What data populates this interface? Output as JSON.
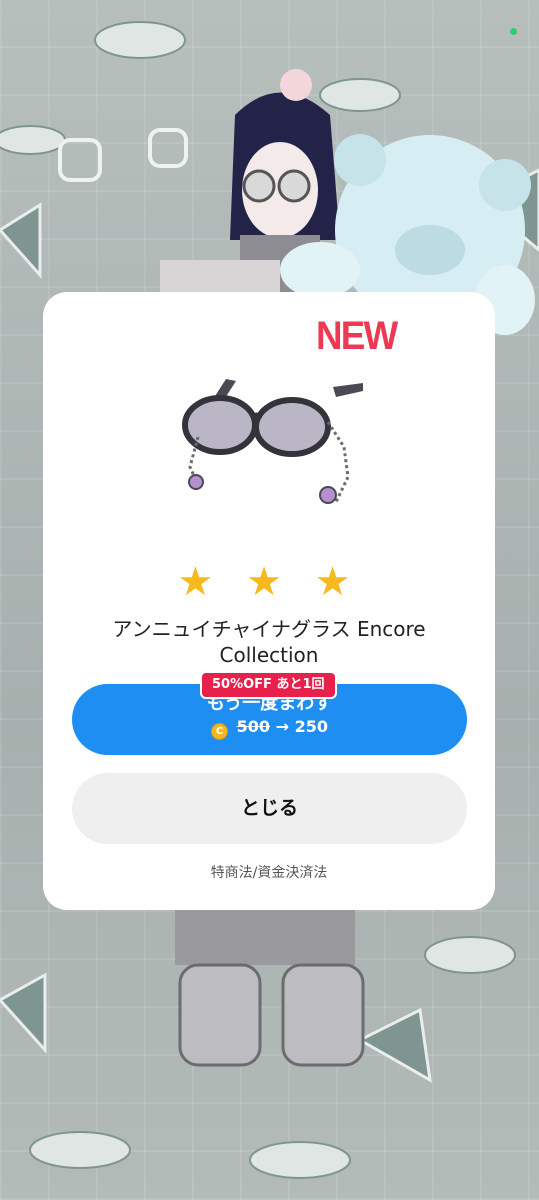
{
  "modal": {
    "new_badge": "NEW",
    "item_icon": "round-sunglasses-with-bead-chains",
    "rarity_stars": 3,
    "stars": [
      "★",
      "★",
      "★"
    ],
    "item_name": "アンニュイチャイナグラス Encore Collection",
    "discount_badge": "50%OFF あと1回",
    "spin_button": {
      "label": "もう一度まわす",
      "coin_icon": "C",
      "old_price": "500",
      "arrow": "→",
      "new_price": "250"
    },
    "close_button": "とじる",
    "legal_link": "特商法/資金決済法"
  },
  "colors": {
    "new_badge": "#ec3a55",
    "star": "#f6b91e",
    "primary_button": "#1e8ef2",
    "discount_badge": "#e8204c",
    "secondary_button": "#efefef",
    "coin": "#f3b81c"
  }
}
